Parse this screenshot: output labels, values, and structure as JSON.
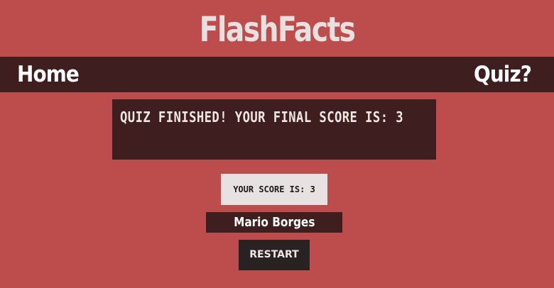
{
  "app": {
    "title": "FlashFacts"
  },
  "nav": {
    "home_label": "Home",
    "quiz_label": "Quiz?"
  },
  "result": {
    "message": "QUIZ FINISHED! YOUR FINAL SCORE IS: 3"
  },
  "score": {
    "label": "YOUR SCORE IS: 3"
  },
  "player": {
    "name": "Mario Borges"
  },
  "actions": {
    "restart_label": "RESTART"
  },
  "colors": {
    "background": "#bd4d4d",
    "navbar": "#3e1e1e",
    "panel": "#3e1e1e",
    "score_box": "#e8e1e2",
    "restart_button": "#292222",
    "logo_text": "#e8dfe0"
  }
}
